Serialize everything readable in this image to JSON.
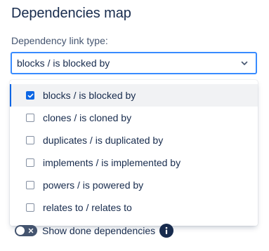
{
  "header": {
    "title": "Dependencies map"
  },
  "link_type_field": {
    "label": "Dependency link type:",
    "selected_value": "blocks / is blocked by"
  },
  "dropdown": {
    "options": [
      {
        "label": "blocks / is blocked by",
        "checked": true
      },
      {
        "label": "clones / is cloned by",
        "checked": false
      },
      {
        "label": "duplicates / is duplicated by",
        "checked": false
      },
      {
        "label": "implements / is implemented by",
        "checked": false
      },
      {
        "label": "powers / is powered by",
        "checked": false
      },
      {
        "label": "relates to / relates to",
        "checked": false
      }
    ]
  },
  "show_done": {
    "label": "Show done dependencies",
    "enabled": false
  },
  "colors": {
    "accent": "#0c66e4",
    "focus_border": "#388bff",
    "text": "#172b4d",
    "toggle_off": "#44546f"
  },
  "icons": {
    "select_chevron": "chevron-down-icon",
    "checkbox_check": "check-icon",
    "toggle_off": "cross-icon",
    "info": "info-icon"
  }
}
